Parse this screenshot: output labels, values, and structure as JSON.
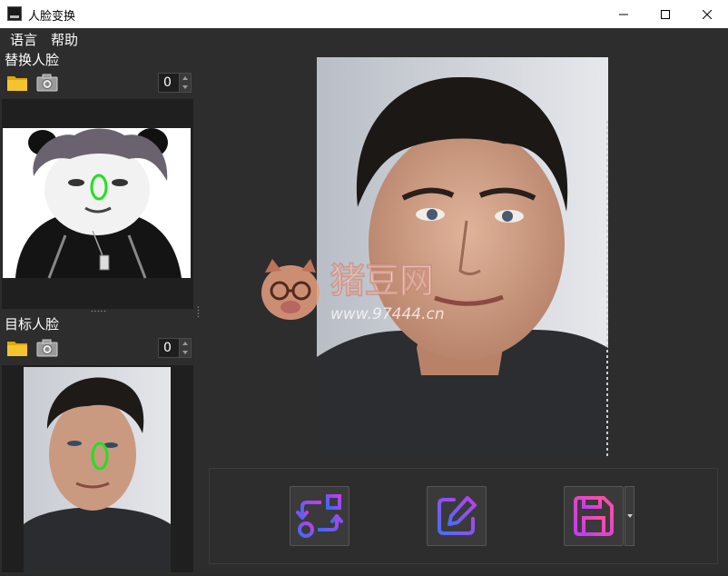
{
  "window": {
    "title": "人脸变换",
    "controls": {
      "minimize": "minimize-icon",
      "maximize": "maximize-icon",
      "close": "close-icon"
    }
  },
  "menu": {
    "items": [
      {
        "label": "语言"
      },
      {
        "label": "帮助"
      }
    ]
  },
  "source_face": {
    "label": "替换人脸",
    "open_icon": "folder-icon",
    "camera_icon": "camera-icon",
    "index_value": "0"
  },
  "target_face": {
    "label": "目标人脸",
    "open_icon": "folder-icon",
    "camera_icon": "camera-icon",
    "index_value": "0"
  },
  "watermark": {
    "name": "猪豆网",
    "url": "www.97444.cn"
  },
  "toolbar": {
    "swap_icon": "swap-icon",
    "edit_icon": "edit-icon",
    "save_icon": "save-icon",
    "save_menu_icon": "dropdown-arrow-icon"
  },
  "colors": {
    "background": "#2d2d2d",
    "panel": "#1f1f1f",
    "titlebar": "#ffffff",
    "face_marker": "#22e022",
    "accent_blue": "#4a6cf7",
    "accent_magenta": "#c43cf0",
    "folder": "#f4c430"
  }
}
